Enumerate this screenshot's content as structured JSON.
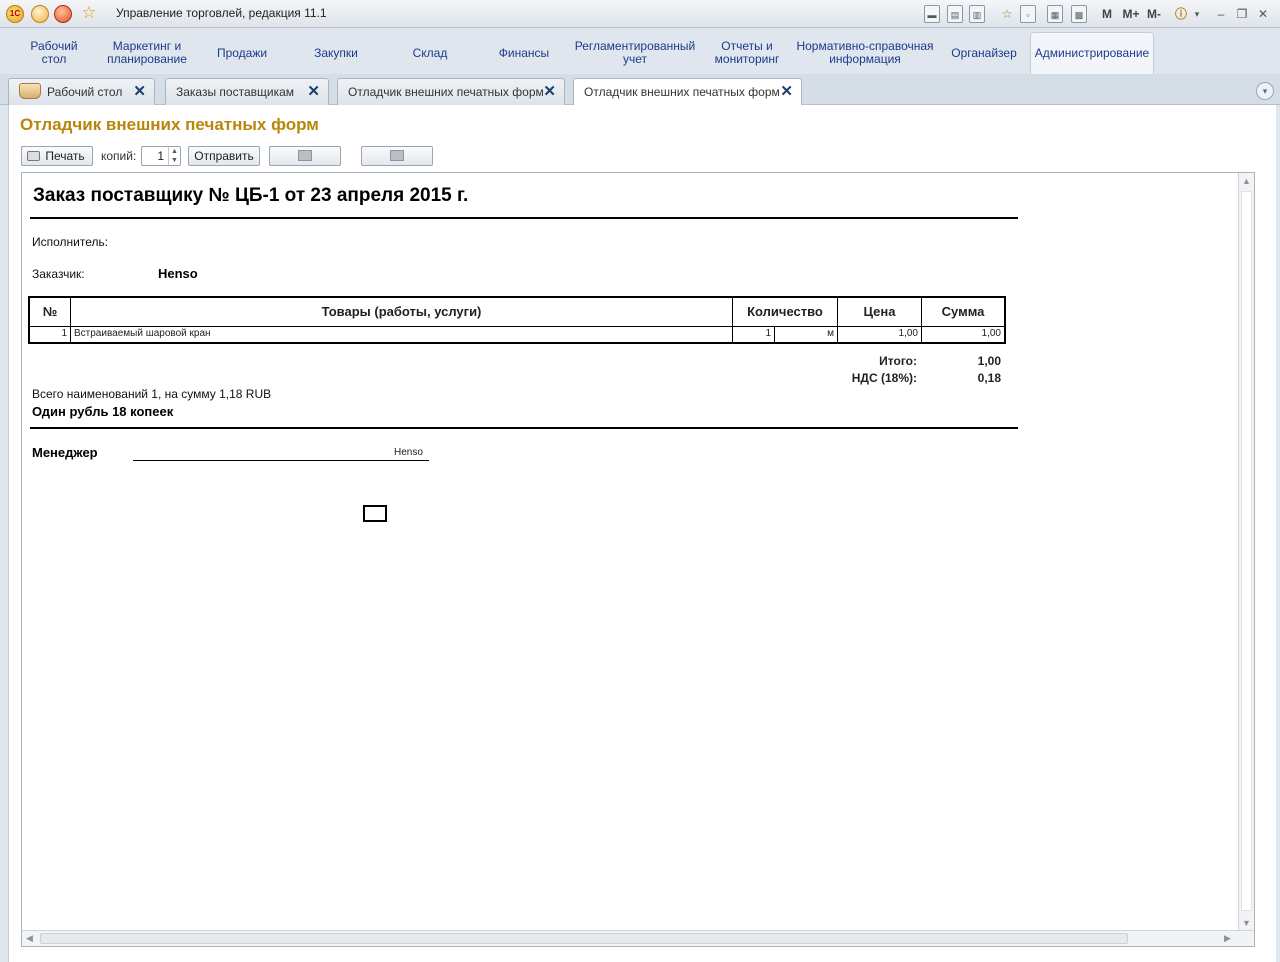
{
  "window": {
    "title": "Управление торговлей, редакция 11.1",
    "logo_text": "1С",
    "tools": [
      "M",
      "M+",
      "M-"
    ]
  },
  "sections": [
    {
      "label": "Рабочий\nстол"
    },
    {
      "label": "Маркетинг и\nпланирование"
    },
    {
      "label": "Продажи"
    },
    {
      "label": "Закупки"
    },
    {
      "label": "Склад"
    },
    {
      "label": "Финансы"
    },
    {
      "label": "Регламентированный\nучет"
    },
    {
      "label": "Отчеты и\nмониторинг"
    },
    {
      "label": "Нормативно-справочная\nинформация"
    },
    {
      "label": "Органайзер"
    },
    {
      "label": "Администрирование"
    }
  ],
  "tabs": [
    {
      "label": "Рабочий стол"
    },
    {
      "label": "Заказы поставщикам"
    },
    {
      "label": "Отладчик внешних печатных форм"
    },
    {
      "label": "Отладчик внешних печатных форм"
    }
  ],
  "form": {
    "title": "Отладчик внешних печатных форм",
    "print_label": "Печать",
    "copies_label": "копий:",
    "copies_value": "1",
    "send_label": "Отправить"
  },
  "document": {
    "title": "Заказ поставщику № ЦБ-1 от 23 апреля 2015 г.",
    "executor_label": "Исполнитель:",
    "customer_label": "Заказчик:",
    "customer_value": "Hensо",
    "columns": [
      "№",
      "Товары (работы, услуги)",
      "Количество",
      "Цена",
      "Сумма"
    ],
    "rows": [
      {
        "num": "1",
        "name": "Встраиваемый шаровой кран",
        "qty": "1",
        "unit": "м",
        "price": "1,00",
        "sum": "1,00"
      }
    ],
    "total_label": "Итого:",
    "total_value": "1,00",
    "vat_label": "НДС (18%):",
    "vat_value": "0,18",
    "summary_line": "Всего наименований 1, на сумму 1,18 RUB",
    "amount_words": "Один рубль 18 копеек",
    "manager_label": "Менеджер",
    "manager_value": "Hensо"
  }
}
